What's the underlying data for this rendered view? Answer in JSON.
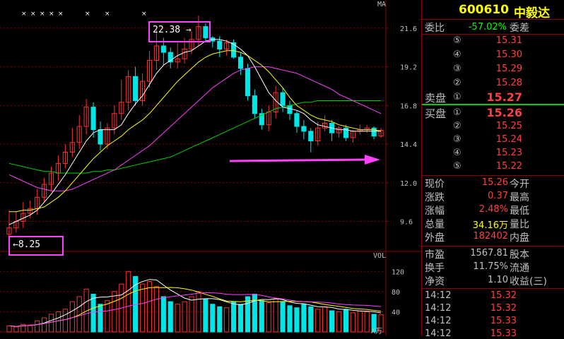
{
  "stock": {
    "code": "600610",
    "name": "中毅达"
  },
  "header": {
    "wb_label": "委比",
    "wb_value": "-57.02%",
    "wc_label": "委差"
  },
  "sell_orders": [
    {
      "n": "⑤",
      "price": "15.31"
    },
    {
      "n": "④",
      "price": "15.30"
    },
    {
      "n": "③",
      "price": "15.29"
    },
    {
      "n": "②",
      "price": "15.28"
    },
    {
      "n": "①",
      "price": "15.27",
      "label": "卖盘"
    }
  ],
  "buy_orders": [
    {
      "n": "①",
      "price": "15.26",
      "label": "买盘"
    },
    {
      "n": "②",
      "price": "15.25"
    },
    {
      "n": "③",
      "price": "15.24"
    },
    {
      "n": "④",
      "price": "15.23"
    },
    {
      "n": "⑤",
      "price": "15.22"
    }
  ],
  "stats": [
    {
      "l": "现价",
      "v": "15.26",
      "r": "今开",
      "color": "#ff4040"
    },
    {
      "l": "涨跌",
      "v": "0.37",
      "r": "最高",
      "color": "#ff4040"
    },
    {
      "l": "涨幅",
      "v": "2.48%",
      "r": "最低",
      "color": "#ff4040"
    },
    {
      "l": "总量",
      "v": "34.16万",
      "r": "量比",
      "color": "#ffff00"
    },
    {
      "l": "外盘",
      "v": "182402",
      "r": "内盘",
      "color": "#ff4040"
    }
  ],
  "stats2": [
    {
      "l": "市盈",
      "v": "1567.81",
      "r": "股本",
      "color": "#c0c0c0"
    },
    {
      "l": "换手",
      "v": "11.75%",
      "r": "流通",
      "color": "#c0c0c0"
    },
    {
      "l": "净资",
      "v": "1.10",
      "r": "收益(三)",
      "color": "#c0c0c0"
    }
  ],
  "ticks": [
    {
      "t": "14:12",
      "p": "15.32"
    },
    {
      "t": "14:12",
      "p": "15.32"
    },
    {
      "t": "14:12",
      "p": "15.33"
    },
    {
      "t": "14:12",
      "p": "15.33"
    }
  ],
  "chart": {
    "ma_label": "MA",
    "vol_label": "VOL",
    "vol_unit": "X万",
    "price_ticks": [
      "21.6",
      "19.2",
      "16.8",
      "14.4",
      "12.0",
      "9.6"
    ],
    "vol_ticks": [
      "120",
      "80",
      "40"
    ],
    "high_annotation": "22.38",
    "low_annotation": "8.25",
    "colors": {
      "up": "#ff3030",
      "down": "#00e5e5",
      "ma5": "#ffffff",
      "ma10": "#ffff00",
      "ma20": "#ff40ff",
      "ma60": "#00d000",
      "arrow": "#ff40ff"
    }
  },
  "chart_data": {
    "type": "candlestick",
    "ylim": [
      8.0,
      23.0
    ],
    "candles": [
      [
        8.8,
        9.2,
        10.3,
        8.3
      ],
      [
        9.2,
        9.6,
        10.2,
        8.9
      ],
      [
        9.6,
        10.1,
        10.8,
        9.2
      ],
      [
        10.1,
        10.4,
        10.9,
        9.8
      ],
      [
        10.4,
        11.1,
        11.6,
        10.0
      ],
      [
        11.1,
        11.9,
        12.3,
        10.8
      ],
      [
        11.9,
        12.6,
        13.0,
        11.5
      ],
      [
        12.6,
        13.2,
        13.7,
        12.1
      ],
      [
        13.2,
        13.9,
        14.4,
        12.9
      ],
      [
        13.9,
        14.5,
        15.4,
        13.6
      ],
      [
        14.5,
        15.5,
        16.2,
        14.1
      ],
      [
        15.5,
        16.7,
        17.2,
        15.0
      ],
      [
        16.7,
        15.3,
        17.0,
        14.8
      ],
      [
        15.3,
        14.4,
        15.8,
        14.0
      ],
      [
        14.4,
        15.4,
        15.7,
        14.1
      ],
      [
        15.4,
        16.3,
        16.8,
        15.0
      ],
      [
        16.3,
        17.0,
        18.4,
        15.9
      ],
      [
        17.0,
        18.6,
        19.0,
        16.5
      ],
      [
        18.6,
        17.1,
        19.2,
        16.8
      ],
      [
        17.1,
        18.3,
        18.8,
        16.8
      ],
      [
        18.3,
        19.6,
        20.2,
        17.9
      ],
      [
        19.6,
        20.5,
        21.5,
        19.0
      ],
      [
        20.5,
        20.1,
        21.0,
        19.3
      ],
      [
        20.1,
        19.5,
        20.4,
        19.1
      ],
      [
        19.5,
        19.7,
        20.7,
        19.1
      ],
      [
        19.7,
        20.3,
        21.0,
        19.4
      ],
      [
        20.3,
        20.9,
        21.4,
        20.0
      ],
      [
        20.9,
        21.7,
        22.38,
        20.5
      ],
      [
        21.7,
        21.0,
        21.9,
        20.8
      ],
      [
        21.0,
        20.8,
        21.1,
        20.4
      ],
      [
        20.8,
        20.3,
        21.1,
        19.8
      ],
      [
        20.3,
        20.7,
        20.9,
        19.9
      ],
      [
        20.7,
        19.8,
        20.9,
        19.7
      ],
      [
        19.8,
        19.1,
        20.1,
        18.7
      ],
      [
        19.1,
        17.4,
        19.4,
        17.1
      ],
      [
        17.4,
        16.3,
        17.8,
        16.0
      ],
      [
        16.3,
        15.6,
        16.6,
        15.3
      ],
      [
        15.6,
        16.4,
        16.8,
        15.2
      ],
      [
        16.4,
        17.6,
        18.0,
        16.0
      ],
      [
        17.6,
        16.8,
        17.9,
        16.4
      ],
      [
        16.8,
        16.3,
        17.1,
        15.9
      ],
      [
        16.3,
        15.5,
        16.5,
        15.1
      ],
      [
        15.5,
        15.2,
        15.9,
        14.7
      ],
      [
        15.2,
        14.6,
        15.4,
        13.9
      ],
      [
        14.6,
        15.4,
        15.8,
        14.3
      ],
      [
        15.4,
        15.7,
        16.2,
        15.2
      ],
      [
        15.7,
        15.1,
        15.9,
        14.6
      ],
      [
        15.1,
        15.4,
        15.5,
        14.8
      ],
      [
        15.4,
        14.8,
        15.6,
        14.6
      ],
      [
        14.8,
        15.2,
        15.3,
        14.5
      ],
      [
        15.2,
        15.3,
        15.6,
        15.0
      ],
      [
        15.3,
        15.4,
        15.6,
        15.1
      ],
      [
        15.4,
        14.9,
        15.5,
        14.7
      ],
      [
        14.9,
        15.26,
        15.4,
        14.8
      ]
    ],
    "volumes": [
      12,
      10,
      15,
      14,
      22,
      28,
      35,
      40,
      45,
      60,
      70,
      85,
      75,
      55,
      62,
      80,
      95,
      120,
      110,
      95,
      100,
      90,
      70,
      60,
      55,
      60,
      70,
      80,
      65,
      55,
      50,
      48,
      60,
      55,
      70,
      75,
      62,
      58,
      65,
      60,
      52,
      48,
      55,
      50,
      45,
      50,
      42,
      40,
      45,
      38,
      42,
      40,
      35,
      34
    ],
    "ma": {
      "ma5": [
        9.4,
        9.6,
        9.8,
        10.0,
        10.3,
        10.8,
        11.3,
        11.9,
        12.5,
        13.2,
        13.9,
        14.6,
        15.1,
        15.3,
        15.3,
        15.3,
        15.6,
        16.3,
        16.9,
        17.4,
        18.1,
        18.8,
        19.3,
        19.6,
        19.9,
        20.1,
        20.2,
        20.5,
        20.8,
        20.9,
        20.9,
        20.8,
        20.6,
        20.3,
        19.9,
        19.2,
        18.4,
        17.6,
        17.1,
        16.7,
        16.6,
        16.5,
        16.3,
        15.9,
        15.6,
        15.5,
        15.4,
        15.3,
        15.3,
        15.2,
        15.2,
        15.2,
        15.2,
        15.2
      ],
      "ma10": [
        10.2,
        10.2,
        10.3,
        10.3,
        10.4,
        10.5,
        10.8,
        11.1,
        11.5,
        12.0,
        12.5,
        13.0,
        13.5,
        13.9,
        14.3,
        14.6,
        14.9,
        15.3,
        15.6,
        15.9,
        16.3,
        16.8,
        17.3,
        17.8,
        18.3,
        18.7,
        19.1,
        19.5,
        19.8,
        20.0,
        20.1,
        20.2,
        20.2,
        20.1,
        19.9,
        19.6,
        19.3,
        18.9,
        18.4,
        17.9,
        17.3,
        16.8,
        16.5,
        16.2,
        16.0,
        15.9,
        15.8,
        15.6,
        15.5,
        15.4,
        15.3,
        15.3,
        15.3,
        15.2
      ],
      "ma20": [
        12.5,
        12.3,
        12.1,
        11.9,
        11.7,
        11.6,
        11.5,
        11.5,
        11.5,
        11.6,
        11.8,
        12.0,
        12.2,
        12.4,
        12.6,
        12.8,
        13.1,
        13.4,
        13.7,
        14.0,
        14.3,
        14.7,
        15.1,
        15.5,
        15.9,
        16.3,
        16.7,
        17.1,
        17.5,
        17.9,
        18.2,
        18.5,
        18.8,
        19.0,
        19.1,
        19.2,
        19.2,
        19.2,
        19.1,
        19.0,
        18.9,
        18.8,
        18.6,
        18.4,
        18.2,
        18.0,
        17.8,
        17.5,
        17.3,
        17.1,
        16.9,
        16.7,
        16.5,
        16.3
      ],
      "ma60": [
        13.2,
        13.1,
        13.0,
        12.9,
        12.8,
        12.7,
        12.7,
        12.6,
        12.6,
        12.6,
        12.6,
        12.6,
        12.7,
        12.7,
        12.8,
        12.8,
        12.9,
        13.0,
        13.1,
        13.2,
        13.3,
        13.4,
        13.5,
        13.6,
        13.8,
        14.0,
        14.2,
        14.4,
        14.6,
        14.8,
        15.0,
        15.2,
        15.4,
        15.6,
        15.8,
        16.0,
        16.2,
        16.4,
        16.6,
        16.7,
        16.8,
        16.9,
        17.0,
        17.0,
        17.1,
        17.1,
        17.1,
        17.1,
        17.1,
        17.1,
        17.1,
        17.1,
        17.1,
        17.1
      ]
    }
  }
}
